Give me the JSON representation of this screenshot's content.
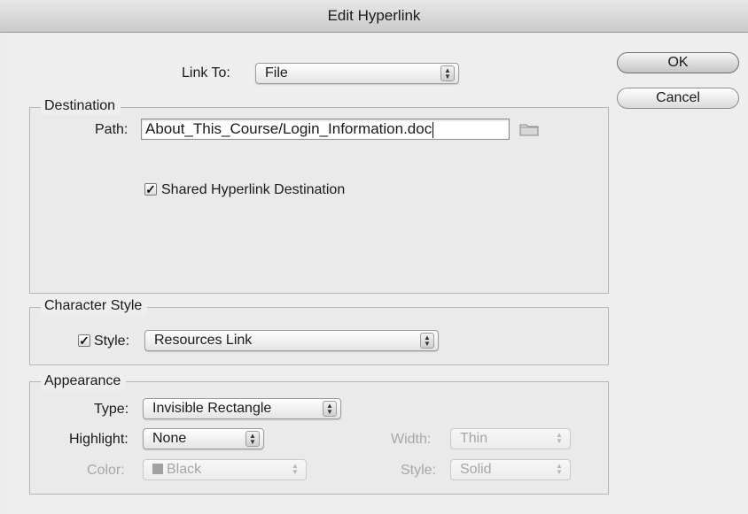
{
  "window": {
    "title": "Edit Hyperlink"
  },
  "link_to": {
    "label": "Link To:",
    "value": "File"
  },
  "buttons": {
    "ok": "OK",
    "cancel": "Cancel"
  },
  "destination": {
    "legend": "Destination",
    "path_label": "Path:",
    "path_value": "About_This_Course/Login_Information.doc",
    "shared_label": "Shared Hyperlink Destination",
    "shared_checked": true
  },
  "character_style": {
    "legend": "Character Style",
    "style_label": "Style:",
    "style_checked": true,
    "style_value": "Resources Link"
  },
  "appearance": {
    "legend": "Appearance",
    "type_label": "Type:",
    "type_value": "Invisible Rectangle",
    "highlight_label": "Highlight:",
    "highlight_value": "None",
    "width_label": "Width:",
    "width_value": "Thin",
    "color_label": "Color:",
    "color_value": "Black",
    "style_label": "Style:",
    "style_value": "Solid"
  },
  "icons": {
    "folder": "folder-icon",
    "stepper": "stepper-arrows-icon",
    "check": "checkmark-icon"
  }
}
